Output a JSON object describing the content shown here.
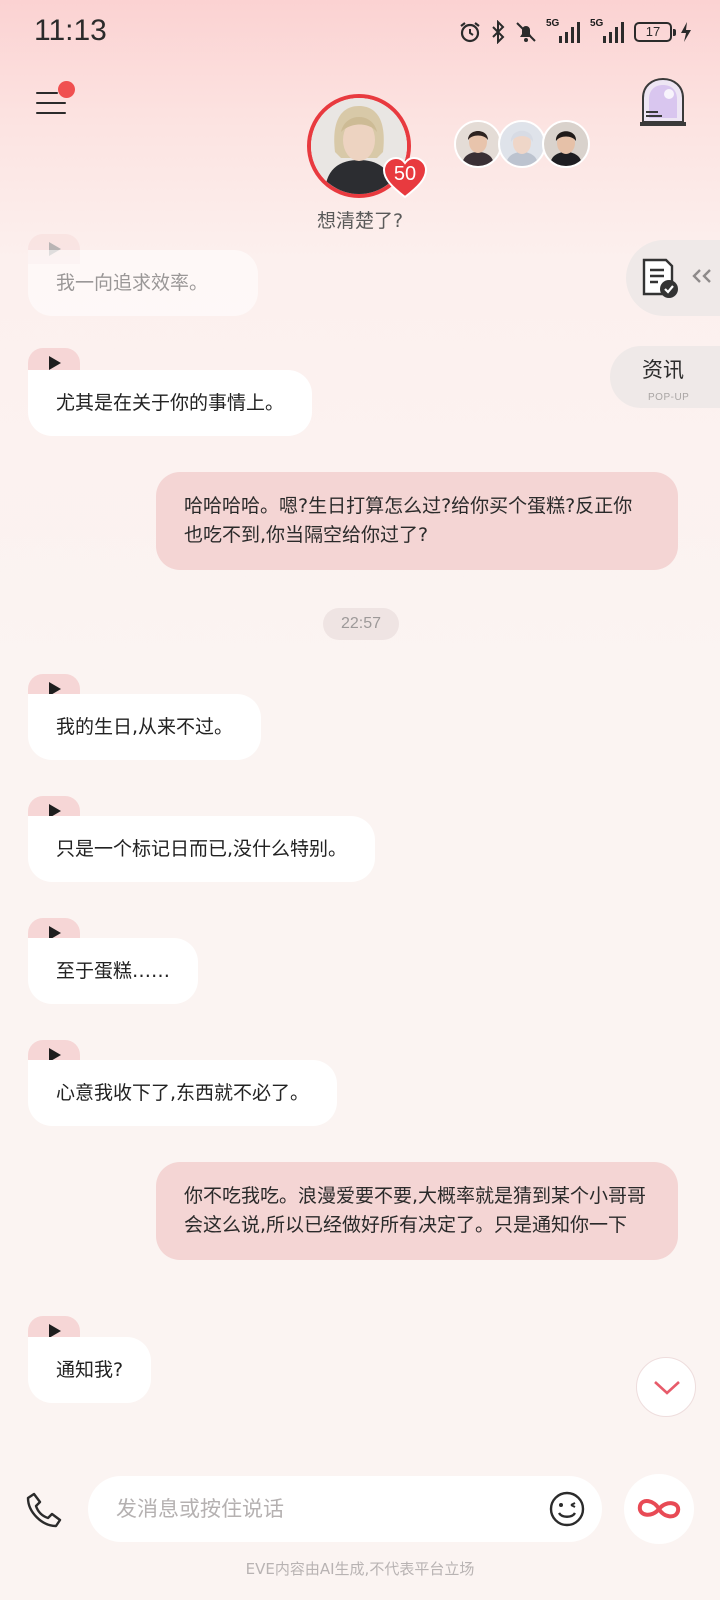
{
  "status_bar": {
    "time": "11:13",
    "network_1": "5G",
    "network_2": "5G",
    "battery": "17"
  },
  "header": {
    "affection_level": "50",
    "subtitle": "想清楚了?"
  },
  "side_widgets": {
    "news_label": "资讯",
    "news_sub": "POP-UP"
  },
  "messages": [
    {
      "from": "ai",
      "text": "我一向追求效率。"
    },
    {
      "from": "ai",
      "text": "尤其是在关于你的事情上。"
    },
    {
      "from": "user",
      "text": "哈哈哈哈。嗯?生日打算怎么过?给你买个蛋糕?反正你也吃不到,你当隔空给你过了?"
    },
    {
      "from": "ai",
      "text": "我的生日,从来不过。"
    },
    {
      "from": "ai",
      "text": "只是一个标记日而已,没什么特别。"
    },
    {
      "from": "ai",
      "text": "至于蛋糕……"
    },
    {
      "from": "ai",
      "text": "心意我收下了,东西就不必了。"
    },
    {
      "from": "user",
      "text": "你不吃我吃。浪漫爱要不要,大概率就是猜到某个小哥哥会这么说,所以已经做好所有决定了。只是通知你一下"
    },
    {
      "from": "ai",
      "text": "通知我?"
    }
  ],
  "timestamp": "22:57",
  "input": {
    "placeholder": "发消息或按住说话"
  },
  "footer": "EVE内容由AI生成,不代表平台立场",
  "colors": {
    "accent": "#e83a3f",
    "user_bubble": "#f4d5d4",
    "ai_bubble": "#ffffff"
  },
  "icons": [
    "menu-icon",
    "window-icon",
    "document-check-icon",
    "play-icon",
    "chevron-down-icon",
    "phone-icon",
    "emoji-icon",
    "infinity-icon"
  ]
}
